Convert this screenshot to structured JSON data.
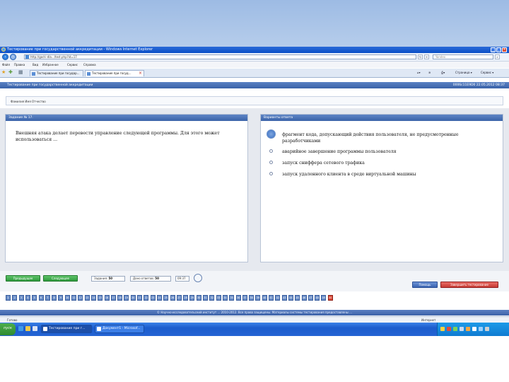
{
  "window": {
    "title": "Тестирование при государственной аккредитации - Windows Internet Explorer",
    "btn_min": "_",
    "btn_max": "□",
    "btn_close": "x"
  },
  "addressbar": {
    "url": "http://god-i-dla.../test.php?id=17",
    "search_placeholder": "Yandex"
  },
  "menu": [
    "Файл",
    "Правка",
    "Вид",
    "Избранное",
    "Сервис",
    "Справка"
  ],
  "tabs": [
    {
      "label": "Тестирование при государ..."
    },
    {
      "label": "Тестирование при госуд..."
    }
  ],
  "commands": {
    "home": "▾",
    "print": "▾",
    "page": "Страница ▾",
    "tools": "Сервис ▾"
  },
  "page": {
    "header_title": "Тестирование при государственной аккредитации",
    "header_info": "0006с11E9D0 22.05.2012 08:37",
    "user_label": "Фамилия Имя Отчество"
  },
  "question": {
    "header": "Задание № 17.",
    "text": "Внешняя атака делает перевести управление следующей программы. Для этого может использоваться ..."
  },
  "answers": {
    "header": "Варианты ответа",
    "options": [
      "фрагмент кода, допускающий действия пользователя, не предусмотренные разработчиками",
      "аварийное завершение программы пользователя",
      "запуск сниффера сетевого трафика",
      "запуск удаленного клиента в среде виртуальной машины"
    ]
  },
  "nav": {
    "prev_label": "Предыдущее",
    "next_label": "Следующее",
    "answered_label": "Задания:",
    "answered_value": "50",
    "remaining_label": "Дано ответов:",
    "remaining_value": "50",
    "time_value": "09:37",
    "help_label": "Помощь",
    "finish_label": "Завершить тестирование"
  },
  "question_numbers": [
    "1",
    "2",
    "3",
    "4",
    "5",
    "6",
    "7",
    "8",
    "9",
    "10",
    "11",
    "12",
    "13",
    "14",
    "15",
    "16",
    "17",
    "18",
    "19",
    "20",
    "21",
    "22",
    "23",
    "24",
    "25",
    "26",
    "27",
    "28",
    "29",
    "30",
    "31",
    "32",
    "33",
    "34",
    "35",
    "36",
    "37",
    "38",
    "39",
    "40",
    "41",
    "42",
    "43",
    "44",
    "45",
    "46",
    "47",
    "48",
    "49",
    "50"
  ],
  "current_question_index": 49,
  "footer": {
    "text": "© Научно-исследовательский институт ... 2010-2012. Все права защищены. Материалы системы тестирования предоставлены ..."
  },
  "status": {
    "text": "Готово",
    "zone": "Интернет"
  },
  "taskbar": {
    "start_label": "пуск",
    "tasks": [
      {
        "label": "Тестирование при г..."
      },
      {
        "label": "Документ1 - Microsof..."
      }
    ]
  }
}
